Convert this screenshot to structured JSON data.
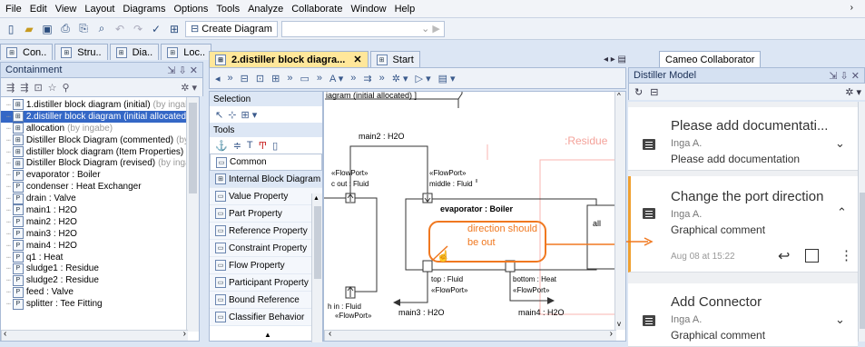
{
  "menu": [
    "File",
    "Edit",
    "View",
    "Layout",
    "Diagrams",
    "Options",
    "Tools",
    "Analyze",
    "Collaborate",
    "Window",
    "Help"
  ],
  "toolbar": {
    "create_diagram": "Create Diagram"
  },
  "left_tabs": [
    "Con..",
    "Stru..",
    "Dia..",
    "Loc.."
  ],
  "containment": {
    "title": "Containment",
    "items": [
      {
        "name": "1.distiller block diagram (initial)",
        "extra": "(by ingab"
      },
      {
        "name": "2.distiller block diagram (initial allocated)",
        "extra": "",
        "selected": true
      },
      {
        "name": "allocation",
        "extra": "(by ingabe)"
      },
      {
        "name": "Distiller Block Diagram (commented)",
        "extra": "(by"
      },
      {
        "name": "distiller block diagram (Item Properties)",
        "extra": ""
      },
      {
        "name": "Distiller Block Diagram (revised)",
        "extra": "(by inga"
      },
      {
        "name": "evaporator : Boiler",
        "extra": ""
      },
      {
        "name": "condenser : Heat Exchanger",
        "extra": ""
      },
      {
        "name": "drain : Valve",
        "extra": ""
      },
      {
        "name": "main1 : H2O",
        "extra": ""
      },
      {
        "name": "main2 : H2O",
        "extra": ""
      },
      {
        "name": "main3 : H2O",
        "extra": ""
      },
      {
        "name": "main4 : H2O",
        "extra": ""
      },
      {
        "name": "q1 : Heat",
        "extra": ""
      },
      {
        "name": "sludge1 : Residue",
        "extra": ""
      },
      {
        "name": "sludge2 : Residue",
        "extra": ""
      },
      {
        "name": "feed : Valve",
        "extra": ""
      },
      {
        "name": "splitter : Tee Fitting",
        "extra": ""
      }
    ]
  },
  "center_tabs": {
    "diagram": "2.distiller block diagra...",
    "start": "Start"
  },
  "palette": {
    "selection": "Selection",
    "tools": "Tools",
    "common": "Common",
    "ibd": "Internal Block Diagram",
    "items": [
      "Value Property",
      "Part Property",
      "Reference Property",
      "Constraint Property",
      "Flow Property",
      "Participant Property",
      "Bound Reference",
      "Classifier Behavior"
    ]
  },
  "diagram": {
    "frame_label": "iagram (initial allocated) ]",
    "main2": "main2 : H2O",
    "residue": ":Residue",
    "flowport1": "«FlowPort»",
    "cout": "c out : Fluid",
    "flowport2": "«FlowPort»",
    "middle": "middle : Fluid",
    "evaporator": "evaporator : Boiler",
    "all": "all",
    "comment_line1": "direction should",
    "comment_line2": "be out",
    "top": "top : Fluid",
    "flowport3": "«FlowPort»",
    "bottom": "bottom : Heat",
    "flowport4": "«FlowPort»",
    "hin": "h in : Fluid",
    "flowport5": "«FlowPort»",
    "main3": "main3 : H2O",
    "main4": "main4 : H2O"
  },
  "right": {
    "tab": "Cameo Collaborator",
    "header": "Distiller Model",
    "comments": [
      {
        "title": "Please add documentati...",
        "author": "Inga A.",
        "body": "Please add documentation",
        "expanded": false
      },
      {
        "title": "Change the port direction",
        "author": "Inga A.",
        "body": "Graphical comment",
        "date": "Aug 08 at 15:22",
        "expanded": true
      },
      {
        "title": "Add Connector",
        "author": "Inga A.",
        "body": "Graphical comment",
        "expanded": false
      }
    ]
  },
  "colors": {
    "accent": "#f0a030",
    "comment_orange": "#f07820",
    "selected": "#3467c6"
  }
}
